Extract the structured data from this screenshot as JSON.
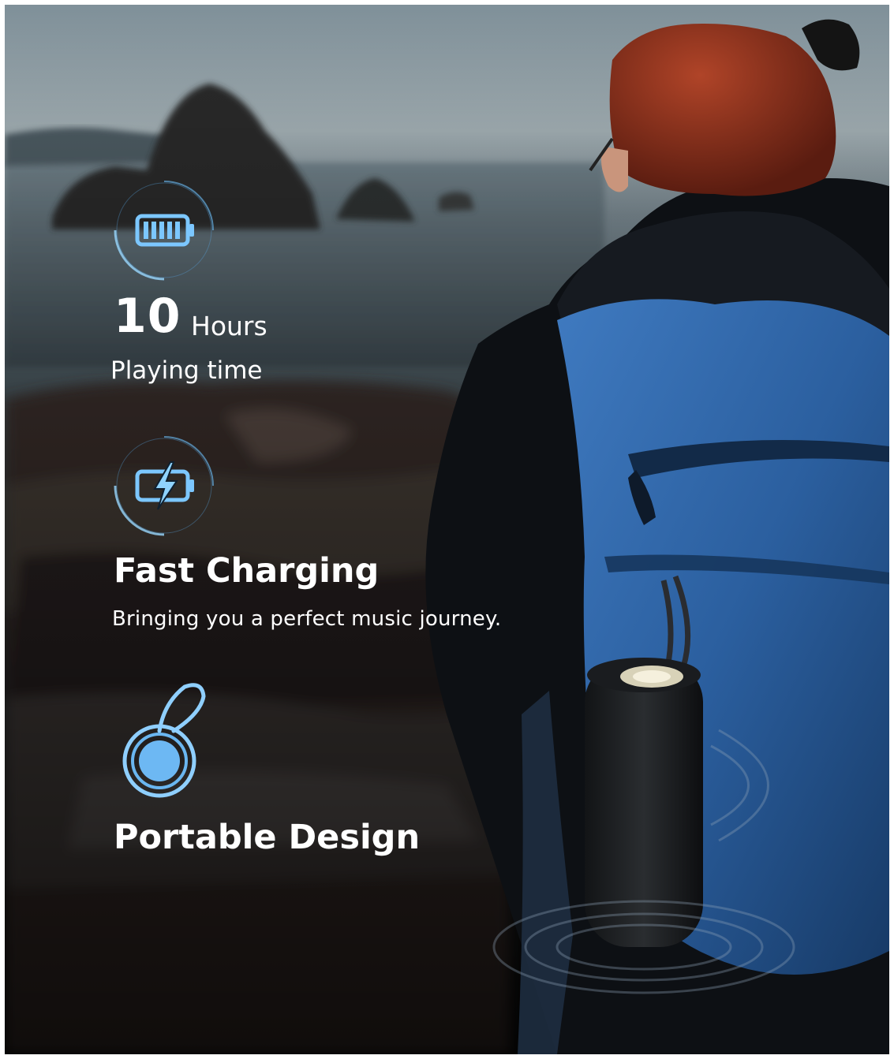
{
  "features": {
    "battery": {
      "icon": "battery-full-icon",
      "value": "10",
      "unit": "Hours",
      "caption": "Playing time"
    },
    "charging": {
      "icon": "battery-charging-icon",
      "title": "Fast Charging",
      "caption": "Bringing you a perfect music journey."
    },
    "portable": {
      "icon": "lanyard-ring-icon",
      "title": "Portable Design"
    }
  },
  "colors": {
    "accent": "#6ec3ff",
    "text": "#ffffff",
    "backpack": "#2d63a3",
    "hair": "#8a2a1a"
  }
}
